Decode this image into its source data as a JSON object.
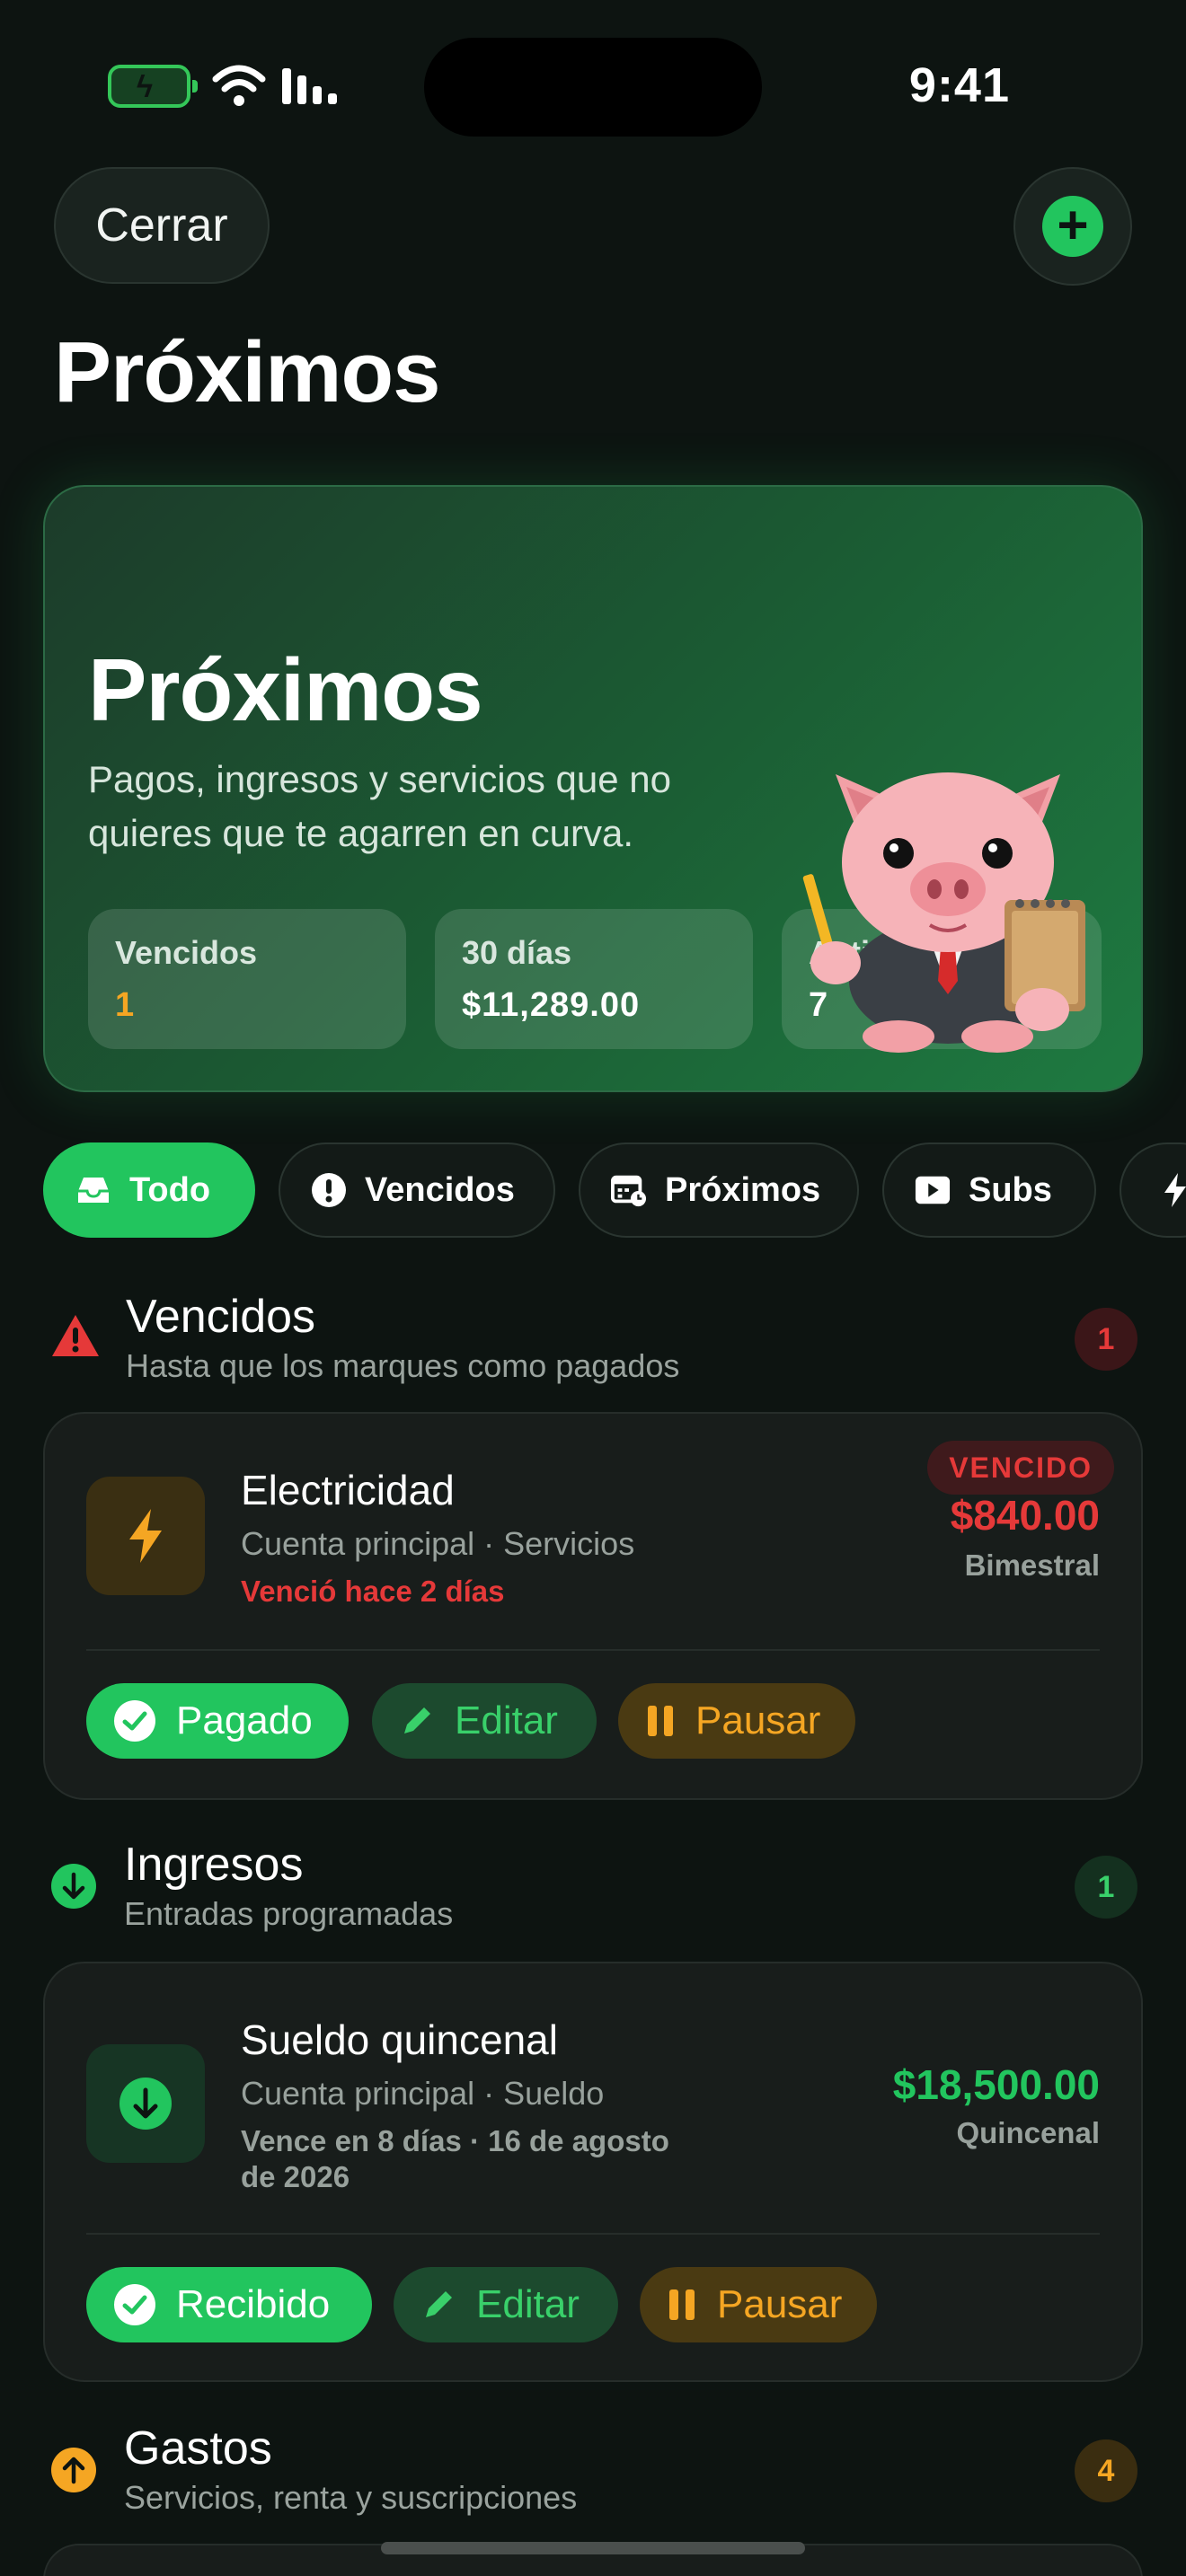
{
  "status_bar": {
    "time": "9:41"
  },
  "header": {
    "close_label": "Cerrar",
    "title": "Próximos"
  },
  "hero": {
    "title": "Próximos",
    "subtitle": "Pagos, ingresos y servicios que no quieres que te agarren en curva.",
    "stats": [
      {
        "label": "Vencidos",
        "value": "1"
      },
      {
        "label": "30 días",
        "value": "$11,289.00"
      },
      {
        "label": "Activos",
        "value": "7"
      }
    ]
  },
  "filters": [
    {
      "label": "Todo",
      "icon": "tray-icon",
      "active": true
    },
    {
      "label": "Vencidos",
      "icon": "exclamation-icon",
      "active": false
    },
    {
      "label": "Próximos",
      "icon": "calendar-clock-icon",
      "active": false
    },
    {
      "label": "Subs",
      "icon": "play-icon",
      "active": false
    },
    {
      "label": "",
      "icon": "bolt-icon",
      "active": false
    }
  ],
  "sections": {
    "vencidos": {
      "title": "Vencidos",
      "subtitle": "Hasta que los marques como pagados",
      "count": "1",
      "item": {
        "name": "Electricidad",
        "meta": "Cuenta principal · Servicios",
        "due": "Venció hace 2 días",
        "badge": "VENCIDO",
        "amount": "$840.00",
        "frequency": "Bimestral",
        "actions": {
          "primary": "Pagado",
          "edit": "Editar",
          "pause": "Pausar"
        }
      }
    },
    "ingresos": {
      "title": "Ingresos",
      "subtitle": "Entradas programadas",
      "count": "1",
      "item": {
        "name": "Sueldo quincenal",
        "meta": "Cuenta principal · Sueldo",
        "due_line1": "Vence en 8 días · 16 de agosto",
        "due_line2": "de 2026",
        "amount": "$18,500.00",
        "frequency": "Quincenal",
        "actions": {
          "primary": "Recibido",
          "edit": "Editar",
          "pause": "Pausar"
        }
      }
    },
    "gastos": {
      "title": "Gastos",
      "subtitle": "Servicios, renta y suscripciones",
      "count": "4"
    }
  },
  "colors": {
    "accent": "#22c55e",
    "danger": "#e53939",
    "warning": "#f5a623",
    "background": "#0d1411"
  }
}
